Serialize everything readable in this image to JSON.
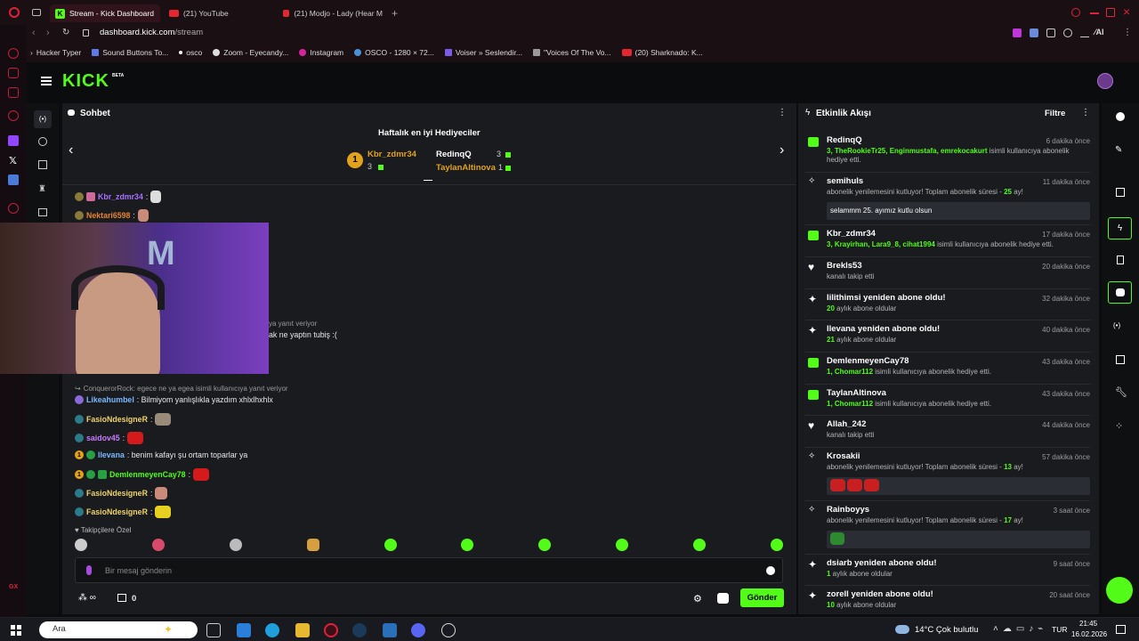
{
  "tabs": [
    {
      "label": "Stream - Kick Dashboard"
    },
    {
      "label": "(21) YouTube"
    },
    {
      "label": "(21) Modjo - Lady (Hear M"
    }
  ],
  "address": {
    "domain": "dashboard.kick.com",
    "path": "/stream"
  },
  "bookmarks": [
    "Hacker Typer",
    "Sound Buttons To...",
    "osco",
    "Zoom - Eyecandy...",
    "Instagram",
    "OSCO - 1280 × 72...",
    "Voiser » Seslendir...",
    "\"Voices Of The Vo...",
    "(20) Sharknado: K..."
  ],
  "kick": {
    "logo": "KICK",
    "beta": "BETA"
  },
  "chat": {
    "title": "Sohbet",
    "top_title": "Haftalık en iyi Hediyeciler",
    "top": [
      {
        "rank": "1",
        "name": "Kbr_zdmr34",
        "count": "3"
      },
      {
        "name": "RedinqQ",
        "count": "3"
      },
      {
        "name": "TaylanAltinova",
        "count": "1"
      }
    ],
    "msgs": [
      {
        "user": "Kbr_zdmr34",
        "color": "#a970ff",
        "text": ":"
      },
      {
        "user": "Nektari6598",
        "color": "#e8832e",
        "text": ":"
      },
      {
        "reply": "ya yanıt veriyor"
      },
      {
        "text": "ak ne yaptın tubiş :("
      },
      {
        "reply": "ConquerorRock: egece ne ya egea isimli kullanıcıya yanıt veriyor"
      },
      {
        "user": "Likeahumbel",
        "color": "#7ab8ff",
        "text": ": Bilmiyom yanlışlıkla yazdım xhlxlhxhlx"
      },
      {
        "user": "FasioNdesigneR",
        "color": "#f0d36c",
        "text": ":"
      },
      {
        "user": "saidov45",
        "color": "#c97bff",
        "text": ":"
      },
      {
        "user": "llevana",
        "color": "#7ab8ff",
        "text": ": benim kafayı şu ortam toparlar ya"
      },
      {
        "user": "DemlenmeyenCay78",
        "color": "#53fc18",
        "text": ":"
      },
      {
        "user": "FasioNdesigneR",
        "color": "#f0d36c",
        "text": ":"
      },
      {
        "user": "FasioNdesigneR",
        "color": "#f0d36c",
        "text": ":"
      }
    ],
    "followers_label": "Takipçilere Özel",
    "input_placeholder": "Bir mesaj gönderin",
    "send": "Gönder",
    "count": "0"
  },
  "activity": {
    "title": "Etkinlik Akışı",
    "filter": "Filtre",
    "items": [
      {
        "user": "RedinqQ",
        "time": "6 dakika önce",
        "desc": "3, TheRookieTr25, Enginmustafa, emrekocakurt",
        "desc2": " isimli kullanıcıya abonelik hediye etti.",
        "icon": "gift"
      },
      {
        "user": "semihuls",
        "time": "11 dakika önce",
        "desc": "abonelik yenilemesini kutluyor! Toplam abonelik süresi - ",
        "g": "25",
        "desc2": " ay!",
        "quote": "selammm 25. ayımız kutlu olsun",
        "icon": "party"
      },
      {
        "user": "Kbr_zdmr34",
        "time": "17 dakika önce",
        "desc": "3, Krayirhan, Lara9_8, cihat1994",
        "desc2": " isimli kullanıcıya abonelik hediye etti.",
        "icon": "gift"
      },
      {
        "user": "Brekls53",
        "time": "20 dakika önce",
        "desc2": "kanalı takip etti",
        "icon": "heart"
      },
      {
        "user": "lilithimsi yeniden abone oldu!",
        "time": "32 dakika önce",
        "desc": "20",
        "desc2": " aylık abone oldular",
        "icon": "star"
      },
      {
        "user": "llevana yeniden abone oldu!",
        "time": "40 dakika önce",
        "desc": "21",
        "desc2": " aylık abone oldular",
        "icon": "star"
      },
      {
        "user": "DemlenmeyenCay78",
        "time": "43 dakika önce",
        "desc": "1, Chomar112",
        "desc2": " isimli kullanıcıya abonelik hediye etti.",
        "icon": "gift"
      },
      {
        "user": "TaylanAltinova",
        "time": "43 dakika önce",
        "desc": "1, Chomar112",
        "desc2": " isimli kullanıcıya abonelik hediye etti.",
        "icon": "gift"
      },
      {
        "user": "Allah_242",
        "time": "44 dakika önce",
        "desc2": "kanalı takip etti",
        "icon": "heart"
      },
      {
        "user": "Krosakii",
        "time": "57 dakika önce",
        "desc": "abonelik yenilemesini kutluyor! Toplam abonelik süresi - ",
        "g": "13",
        "desc2": " ay!",
        "icon": "party"
      },
      {
        "user": "Rainboyys",
        "time": "3 saat önce",
        "desc": "abonelik yenilemesini kutluyor! Toplam abonelik süresi - ",
        "g": "17",
        "desc2": " ay!",
        "icon": "party"
      },
      {
        "user": "dsiarb yeniden abone oldu!",
        "time": "9 saat önce",
        "desc": "1",
        "desc2": " aylık abone oldular",
        "icon": "star"
      },
      {
        "user": "zorell yeniden abone oldu!",
        "time": "20 saat önce",
        "desc": "10",
        "desc2": " aylık abone oldular",
        "icon": "star"
      }
    ]
  },
  "taskbar": {
    "search": "Ara",
    "weather": "14°C  Çok bulutlu",
    "lang": "TUR",
    "time": "21:45",
    "date": "16.02.2026"
  },
  "colors": {
    "accent": "#53fc18",
    "tab_active": "#31131c"
  }
}
